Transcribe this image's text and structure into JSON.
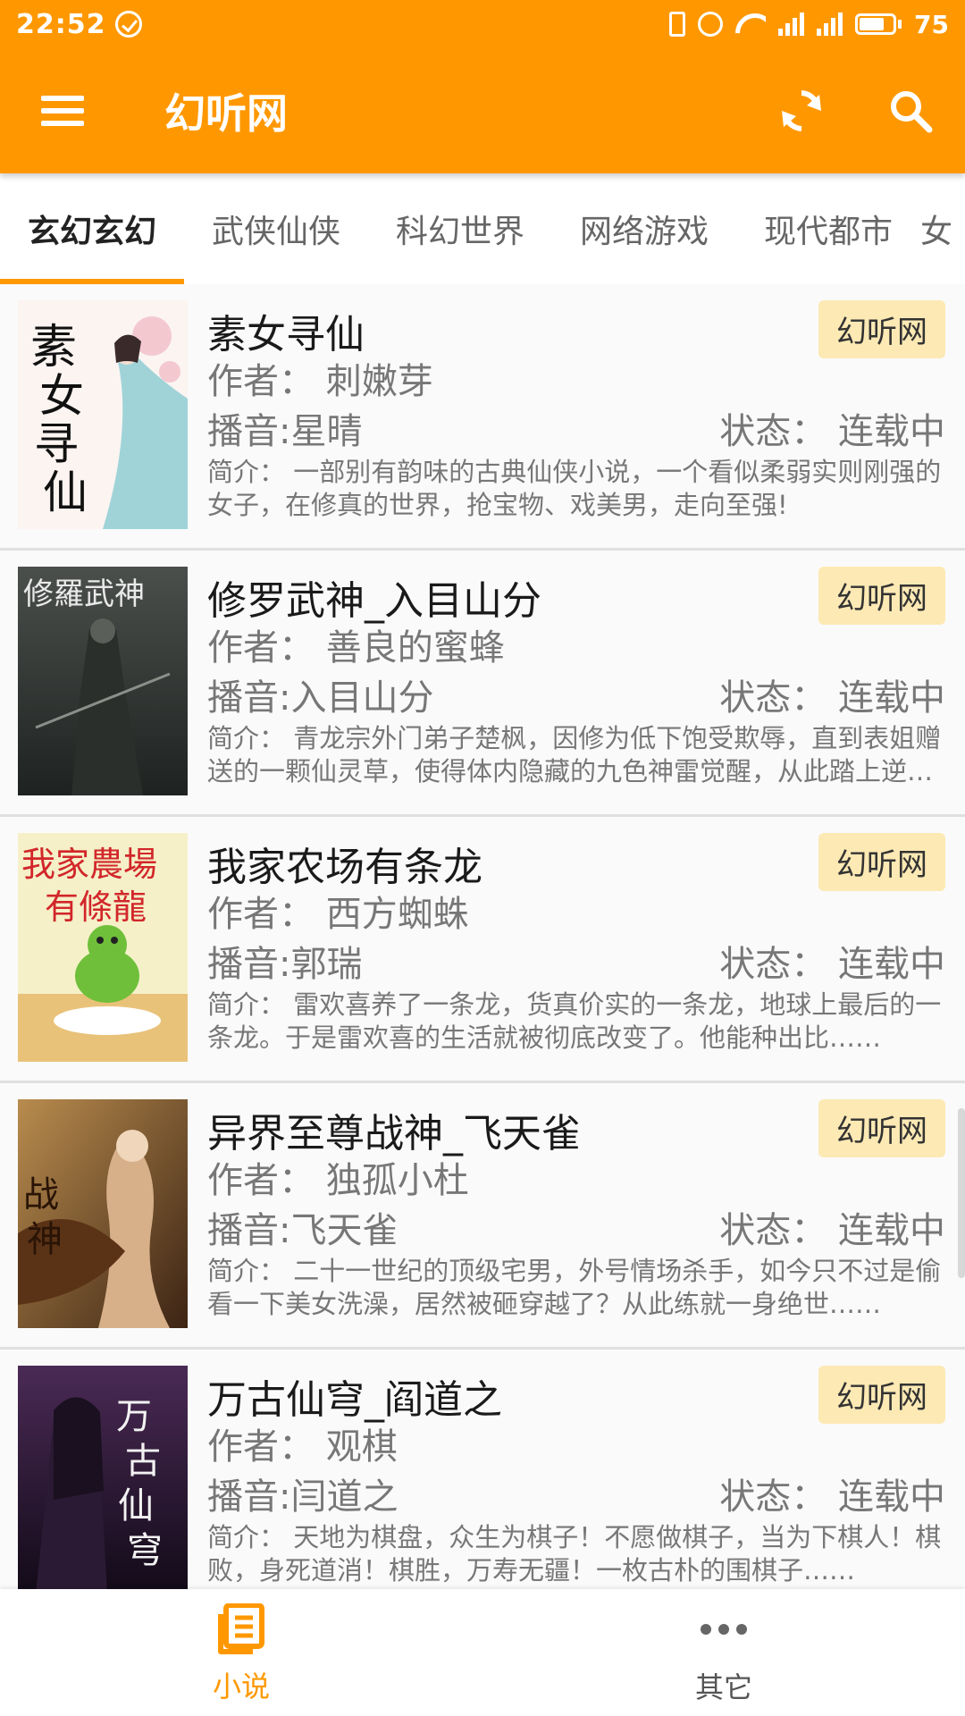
{
  "status_bar": {
    "time": "22:52",
    "battery": "75",
    "network": "4G"
  },
  "app_bar": {
    "title": "幻听网",
    "menu_icon": "hamburger-menu-icon",
    "refresh_icon": "refresh-icon",
    "search_icon": "search-icon"
  },
  "tabs": [
    {
      "label": "玄幻玄幻",
      "active": true
    },
    {
      "label": "武侠仙侠"
    },
    {
      "label": "科幻世界"
    },
    {
      "label": "网络游戏"
    },
    {
      "label": "现代都市"
    },
    {
      "label": "女"
    }
  ],
  "books": [
    {
      "title": "素女寻仙",
      "source": "幻听网",
      "author": "作者：  刺嫩芽",
      "narrator": "播音:星晴",
      "status": "状态：  连载中",
      "intro": "简介：  一部别有韵味的古典仙侠小说，一个看似柔弱实则刚强的女子，在修真的世界，抢宝物、戏美男，走向至强!",
      "cover_text": "素女寻仙"
    },
    {
      "title": "修罗武神_入目山分",
      "source": "幻听网",
      "author": "作者：  善良的蜜蜂",
      "narrator": "播音:入目山分",
      "status": "状态：  连载中",
      "intro": "简介：  青龙宗外门弟子楚枫，因修为低下饱受欺辱，直到表姐赠送的一颗仙灵草，使得体内隐藏的九色神雷觉醒，从此踏上逆天之路……",
      "cover_text": "修羅武神"
    },
    {
      "title": "我家农场有条龙",
      "source": "幻听网",
      "author": "作者：  西方蜘蛛",
      "narrator": "播音:郭瑞",
      "status": "状态：  连载中",
      "intro": "简介：  雷欢喜养了一条龙，货真价实的一条龙，地球上最后的一条龙。于是雷欢喜的生活就被彻底改变了。他能种出比……",
      "cover_text": "我家農場有條龍"
    },
    {
      "title": "异界至尊战神_飞天雀",
      "source": "幻听网",
      "author": "作者：  独孤小杜",
      "narrator": "播音:飞天雀",
      "status": "状态：  连载中",
      "intro": "简介：  二十一世纪的顶级宅男，外号情场杀手，如今只不过是偷看一下美女洗澡，居然被砸穿越了？从此练就一身绝世……",
      "cover_text": "战神"
    },
    {
      "title": "万古仙穹_阎道之",
      "source": "幻听网",
      "author": "作者：  观棋",
      "narrator": "播音:闫道之",
      "status": "状态：  连载中",
      "intro": "简介：  天地为棋盘，众生为棋子！不愿做棋子，当为下棋人！棋败，身死道消！棋胜，万寿无疆！一枚古朴的围棋子……",
      "cover_text": "万古仙穹"
    }
  ],
  "bottom_nav": [
    {
      "label": "小说",
      "icon": "book-list-icon",
      "active": true
    },
    {
      "label": "其它",
      "icon": "more-dots-icon",
      "active": false
    }
  ],
  "colors": {
    "primary": "#ff9800",
    "badge": "#fde9b4"
  }
}
